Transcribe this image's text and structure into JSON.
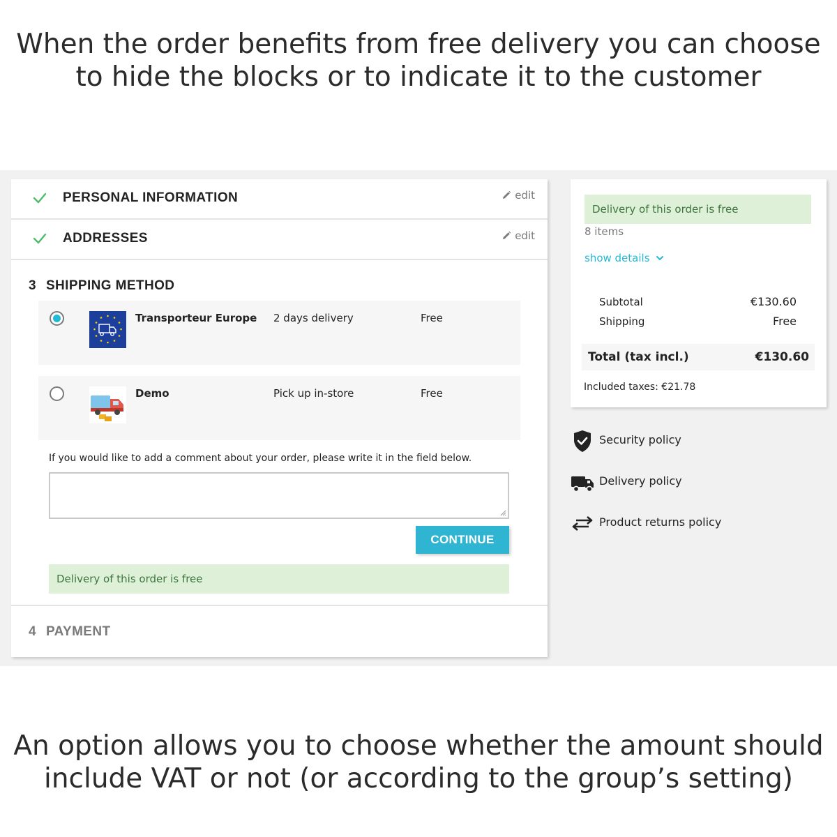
{
  "captions": {
    "top_line1": "When the order benefits from free delivery you can choose",
    "top_line2": "to hide the blocks or to indicate it to the customer",
    "bottom_line1": "An option allows you to choose whether the amount should",
    "bottom_line2": "include VAT or not (or according to the group’s setting)"
  },
  "checkout": {
    "steps": [
      {
        "title": "PERSONAL INFORMATION",
        "edit_label": "edit",
        "complete": true
      },
      {
        "title": "ADDRESSES",
        "edit_label": "edit",
        "complete": true
      }
    ],
    "shipping": {
      "number": "3",
      "title": "SHIPPING METHOD",
      "carriers": [
        {
          "name": "Transporteur Europe",
          "delay": "2 days delivery",
          "price": "Free",
          "selected": true,
          "logo": "eu-truck-icon"
        },
        {
          "name": "Demo",
          "delay": "Pick up in-store",
          "price": "Free",
          "selected": false,
          "logo": "delivery-truck-icon"
        }
      ],
      "comment_label": "If you would like to add a comment about your order, please write it in the field below.",
      "comment_value": "",
      "continue_label": "CONTINUE",
      "free_delivery_notice": "Delivery of this order is free"
    },
    "payment": {
      "number": "4",
      "title": "PAYMENT"
    }
  },
  "summary": {
    "free_delivery_notice": "Delivery of this order is free",
    "items_count": "8 items",
    "show_details": "show details",
    "subtotal_label": "Subtotal",
    "subtotal_value": "€130.60",
    "shipping_label": "Shipping",
    "shipping_value": "Free",
    "total_label": "Total (tax incl.)",
    "total_value": "€130.60",
    "taxes": "Included taxes: €21.78"
  },
  "reassurance": [
    {
      "label": "Security policy",
      "icon": "shield-check-icon"
    },
    {
      "label": "Delivery policy",
      "icon": "truck-icon"
    },
    {
      "label": "Product returns policy",
      "icon": "exchange-arrows-icon"
    }
  ],
  "colors": {
    "accent": "#2fb5d2",
    "success_bg": "#dff0d8",
    "success_text": "#3c763d",
    "check": "#4cbb6c"
  }
}
